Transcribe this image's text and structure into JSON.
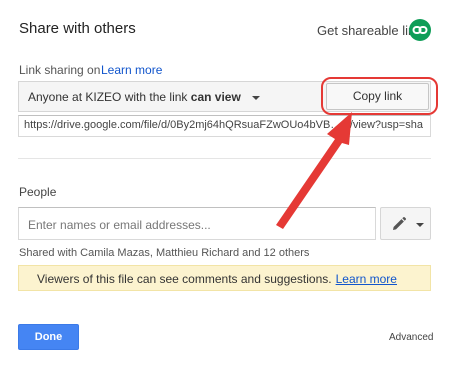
{
  "dialog": {
    "title": "Share with others",
    "get_link_label": "Get shareable link"
  },
  "link_sharing": {
    "label": "Link sharing on",
    "learn_more": "Learn more",
    "access_prefix": "Anyone at KIZEO with the link",
    "access_level": "can view",
    "copy_button": "Copy link",
    "url": "https://drive.google.com/file/d/0By2mj64hQRsuaFZwOUo4bVB…Q/view?usp=sha"
  },
  "people": {
    "label": "People",
    "placeholder": "Enter names or email addresses...",
    "shared_with": "Shared with Camila Mazas, Matthieu Richard and 12 others",
    "permission_icon": "pencil-icon"
  },
  "notice": {
    "text": "Viewers of this file can see comments and suggestions.",
    "learn_more": "Learn more"
  },
  "footer": {
    "done": "Done",
    "advanced": "Advanced"
  },
  "colors": {
    "accent_blue": "#4585f3",
    "link_blue": "#1155cc",
    "link_icon_green": "#0f9d58",
    "notice_bg": "#fcf3cf",
    "annotation_red": "#e53935"
  }
}
